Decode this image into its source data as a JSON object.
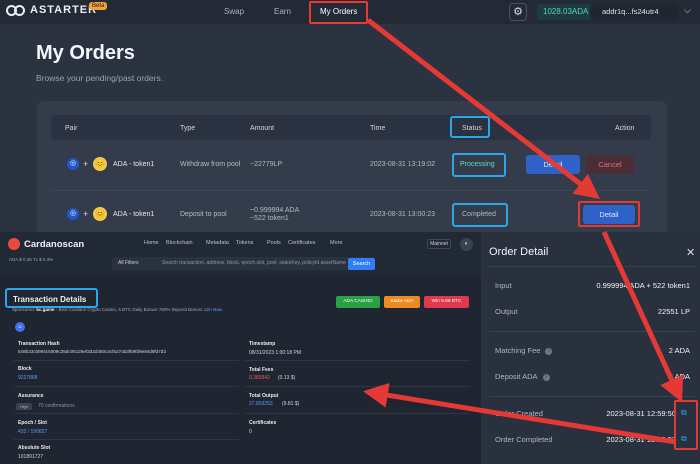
{
  "app": {
    "logo_text": "ASTARTER",
    "beta_label": "Beta",
    "nav": [
      "Swap",
      "Earn",
      "My Orders"
    ],
    "balance": "1028.03ADA",
    "address": "addr1q...fs24utr4"
  },
  "page": {
    "title": "My Orders",
    "subtitle": "Browse your pending/past orders."
  },
  "orders": {
    "headers": [
      "Pair",
      "Type",
      "Amount",
      "Time",
      "Status",
      "Action"
    ],
    "rows": [
      {
        "pair": "ADA - token1",
        "type": "Withdraw from pool",
        "amount": "~22779LP",
        "amount2": "",
        "time": "2023-08-31 13:19:02",
        "status": "Processing",
        "btn1": "Detail",
        "btn2": "Cancel"
      },
      {
        "pair": "ADA - token1",
        "type": "Deposit to pool",
        "amount": "~0.999994 ADA",
        "amount2": "~522 token1",
        "time": "2023-08-31 13:00:23",
        "status": "Completed",
        "btn1": "Detail",
        "btn2": ""
      }
    ]
  },
  "explorer": {
    "name": "Cardanoscan",
    "stats": "ADA $ 0.36    Tx $ 0.3%",
    "nav": [
      "Home",
      "Blockchain",
      "Metadata",
      "Tokens",
      "Pools",
      "Certificates",
      "More"
    ],
    "network": "Mainnet",
    "filter": "All Filters",
    "search_placeholder": "Search transaction, address, block, epoch,slot, pool, stakeKey, policyId.assetName",
    "search_button": "Search",
    "page_title": "Transaction Details",
    "sponsor_prefix": "Sponsored:",
    "sponsor_site": "bc.game",
    "sponsor_text": "- Best Cardano Crypto Casino, 5 BTC Daily Bonus! 760% Deposit Bonus!",
    "sponsor_link": "Join Now",
    "ads": [
      "ADA CASINO",
      "Stake ADA",
      "Win 5.86 BTC"
    ],
    "badge": "☺",
    "fields_left": [
      {
        "label": "Transaction Hash",
        "value": "548b23c0994c5009c35dc06128ef332d450c4cfa27ab3f59fd9e84d9fd7d3"
      },
      {
        "label": "Block",
        "value": "9227868"
      },
      {
        "label": "Assurance",
        "value": "70 confirmations",
        "tag": "High"
      },
      {
        "label": "Epoch / Slot",
        "value": "433 / 190827"
      },
      {
        "label": "Absolute Slot",
        "value": "101891727"
      }
    ],
    "fields_right": [
      {
        "label": "Timestamp",
        "value": "08/31/2023 1:00:18 PM"
      },
      {
        "label": "Total Fees",
        "value": "0.383942",
        "extra": "(0.13 $)"
      },
      {
        "label": "Total Output",
        "value": "27.803253",
        "extra": "(9.81 $)"
      },
      {
        "label": "Certificates",
        "value": "0"
      }
    ]
  },
  "drawer": {
    "title": "Order Detail",
    "close": "✕",
    "rows": [
      {
        "label": "Input",
        "value": "0.999994 ADA + 522 token1"
      },
      {
        "label": "Output",
        "value": "22551 LP"
      },
      {
        "label": "Matching Fee",
        "value": "2 ADA",
        "info": true
      },
      {
        "label": "Deposit ADA",
        "value": "2 ADA",
        "info": true
      },
      {
        "label": "Order Created",
        "value": "2023-08-31 12:59:50",
        "link": true
      },
      {
        "label": "Order Completed",
        "value": "2023-08-31 13:00:23",
        "link": true
      }
    ]
  },
  "colors": {
    "highlight_red": "#e53935",
    "highlight_blue": "#2aa7e8",
    "accent_teal": "#59d1c4",
    "detail_blue": "#2f62c9"
  },
  "icons": [
    "settings-gear-icon",
    "ada-token-icon",
    "token1-face-icon",
    "external-link-icon",
    "close-icon",
    "info-icon",
    "chevron-down-icon"
  ]
}
